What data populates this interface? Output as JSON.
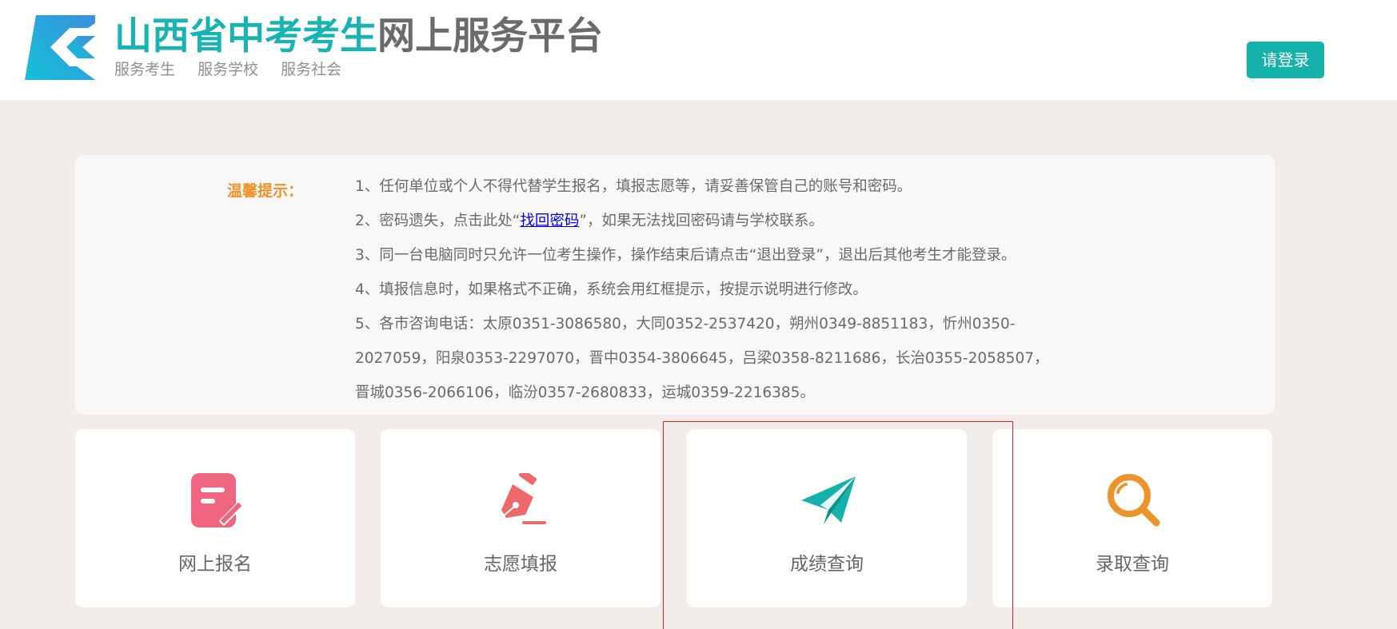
{
  "header": {
    "title_part1": "山西省中考考生",
    "title_part2": "网上服务平台",
    "slogans": [
      "服务考生",
      "服务学校",
      "服务社会"
    ],
    "login_label": "请登录",
    "brand_color": "#1ab3b3"
  },
  "notice": {
    "label": "温馨提示：",
    "line1": "1、任何单位或个人不得代替学生报名，填报志愿等，请妥善保管自己的账号和密码。",
    "line2_before": "2、密码遗失，点击此处“",
    "line2_link": "找回密码",
    "line2_after": "”，如果无法找回密码请与学校联系。",
    "line3": "3、同一台电脑同时只允许一位考生操作，操作结束后请点击“退出登录”，退出后其他考生才能登录。",
    "line4": "4、填报信息时，如果格式不正确，系统会用红框提示，按提示说明进行修改。",
    "line5": "5、各市咨询电话：太原0351-3086580，大同0352-2537420，朔州0349-8851183，忻州0350-2027059，阳泉0353-2297070，晋中0354-3806645，吕梁0358-8211686，长治0355-2058507，晋城0356-2066106，临汾0357-2680833，运城0359-2216385。"
  },
  "cards": [
    {
      "label": "网上报名",
      "icon": "registration-form-icon",
      "color": "#f06680"
    },
    {
      "label": "志愿填报",
      "icon": "fountain-pen-icon",
      "color": "#ee6a6a"
    },
    {
      "label": "成绩查询",
      "icon": "paper-plane-icon",
      "color": "#15b2ac"
    },
    {
      "label": "录取查询",
      "icon": "magnifier-icon",
      "color": "#f0922a"
    }
  ]
}
